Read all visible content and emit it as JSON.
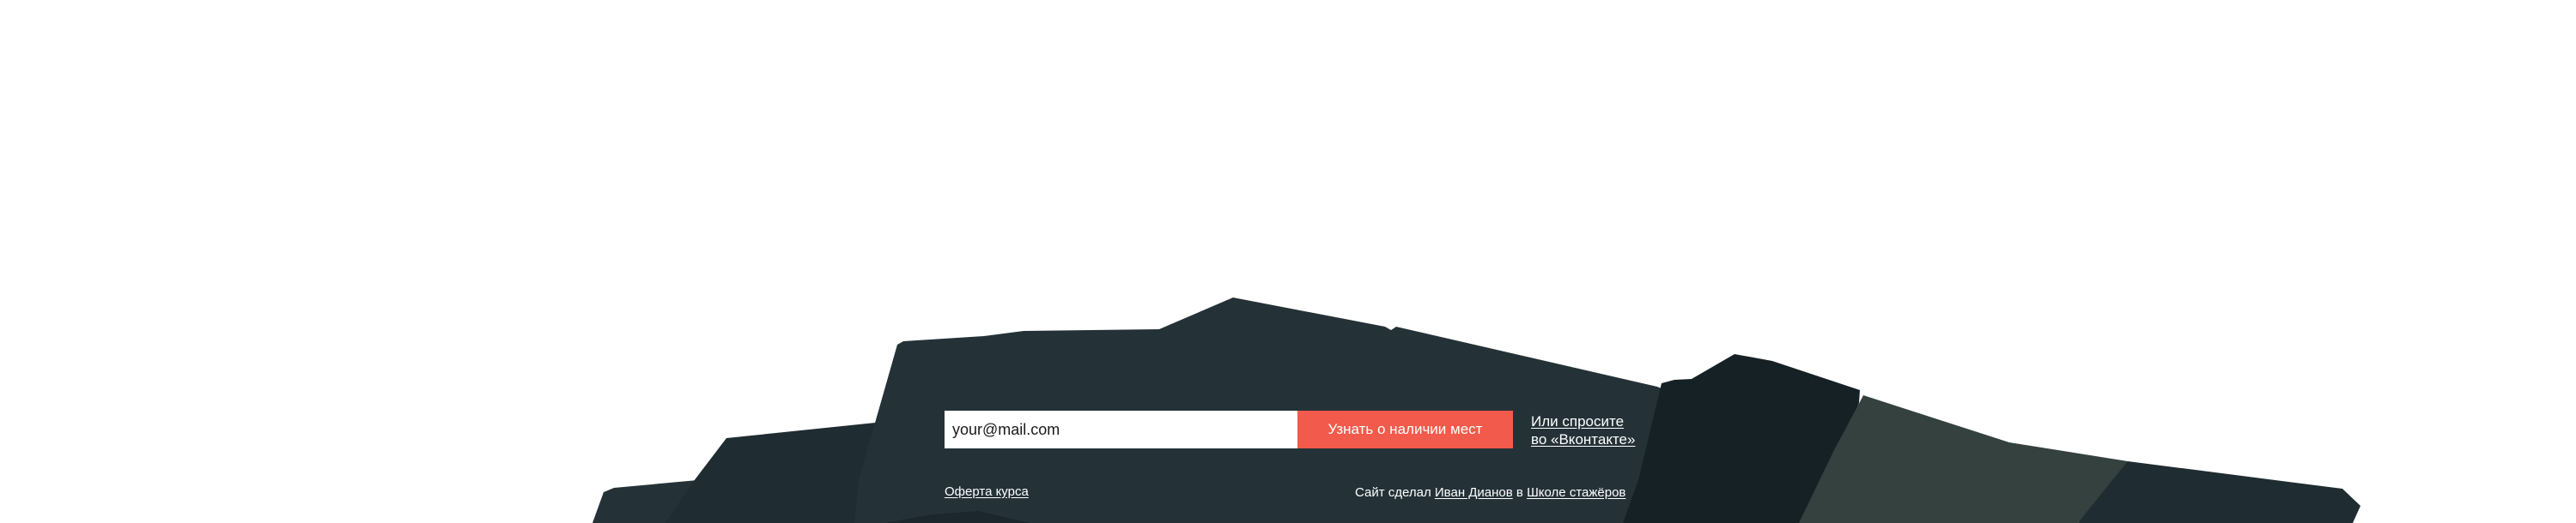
{
  "signup": {
    "email_placeholder": "your@mail.com",
    "submit_label": "Узнать о наличии мест"
  },
  "vk_link": {
    "line1": "Или спросите",
    "line2": "во «Вконтакте»"
  },
  "footer": {
    "offer_link": "Оферта курса",
    "credits_prefix": "Сайт сделал",
    "author_link": "Иван Дианов",
    "credits_middle": "в",
    "school_link": "Школе стажёров"
  },
  "colors": {
    "button_accent": "#f25a4b",
    "mountain_dark": "#243238",
    "mountain_darker": "#162126",
    "mountain_light": "#34413f"
  }
}
